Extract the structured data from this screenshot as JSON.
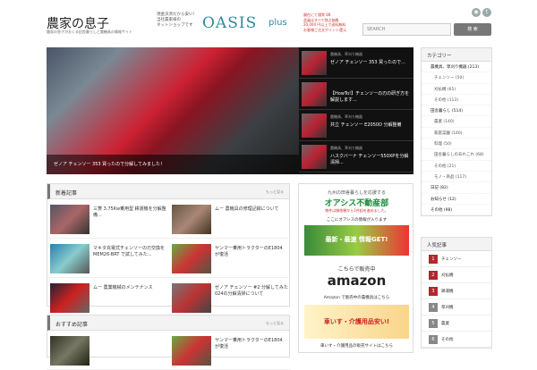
{
  "header": {
    "site_title": "農家の息子",
    "site_description": "農家の息子がおくる田舎暮らしと農機具の情報サイト",
    "banner": {
      "left_text": [
        "現金決済だから安い！",
        "当社農家様の",
        "ネットショップです"
      ],
      "logo": "OASIS",
      "logo_sub": "plus",
      "right_text": [
        "偏在にて通常 88",
        "会員はすべて独占価格",
        "20,000 円以上で送料無料",
        "お客様ご注文ポイント還元"
      ]
    },
    "search": {
      "placeholder": "SEARCH",
      "button_label": "検 索"
    },
    "social": [
      "rss-icon",
      "twitter-icon"
    ]
  },
  "hero": {
    "caption": "ゼノア チェンソー 353 買ったので分解してみました！"
  },
  "slides": [
    {
      "cat": "農機具、草刈り機器",
      "title": "ゼノア チェンソー 353 買ったので..."
    },
    {
      "cat": "",
      "title": "【HowTo!】チェンソーの刃の研ぎ方を解説します..."
    },
    {
      "cat": "農機具、草刈り機器",
      "title": "共立 チェンソー E2050D 分解整備"
    },
    {
      "cat": "農機具、草刈り機器",
      "title": "ハスクバーナ チェンソー550XPを分解清掃..."
    }
  ],
  "section1": {
    "title": "新着記事",
    "more": "もっと見る",
    "posts": [
      {
        "title": "三菱 3.75Kw乗用型 耕運機を分解整備..."
      },
      {
        "title": "ムー 農機具の修理記録について"
      },
      {
        "title": "マキタ充電式チェンソーの刃交換をMEM26-BRT で試してみた..."
      },
      {
        "title": "ヤンマー乗用トラクターのE1804 が復活"
      },
      {
        "title": "ムー 農業機械のメンテナンス"
      },
      {
        "title": "ゼノア チェンソー #2 分解してみた 024の分解清掃について"
      }
    ]
  },
  "section2": {
    "title": "おすすめ記事",
    "more": "もっと見る",
    "posts": [
      {
        "title": ""
      },
      {
        "title": "ヤンマー乗用トラクターのE1804 が復活"
      }
    ]
  },
  "ads": {
    "ad1_title": "九州の田舎暮らしを応援する",
    "ad1_logo": "オアシス不動産部",
    "ad1_sub": "物件は御依頼から1件起を進めました。",
    "ad1_caption": "ここにオアシスの情報が入ります",
    "ad2_text": "最新・最速 情報GET!",
    "ad3_text": "こちらで販売中",
    "ad3_logo": "amazon",
    "ad3_caption": "Amazon で販売中の農機具はこちら",
    "ad4_text": "車いす・介護用品安い!",
    "ad4_caption": "車いす・介護用品の販売サイトはこちら"
  },
  "sidebar": {
    "title": "カテゴリー",
    "categories": [
      {
        "label": "農機具、草刈り機器 (213)",
        "sub": false
      },
      {
        "label": "チェンソー (50)",
        "sub": true
      },
      {
        "label": "刈払機 (65)",
        "sub": true
      },
      {
        "label": "その他 (113)",
        "sub": true
      },
      {
        "label": "田舎暮らし (514)",
        "sub": false
      },
      {
        "label": "農業 (140)",
        "sub": true
      },
      {
        "label": "家庭菜園 (140)",
        "sub": true
      },
      {
        "label": "料理 (50)",
        "sub": true
      },
      {
        "label": "田舎暮らしのあれこれ (68)",
        "sub": true
      },
      {
        "label": "その他 (21)",
        "sub": true
      },
      {
        "label": "モノ・商品 (117)",
        "sub": true
      },
      {
        "label": "日記 (82)",
        "sub": false
      },
      {
        "label": "お知らせ (12)",
        "sub": false
      },
      {
        "label": "その他 (98)",
        "sub": false
      }
    ]
  },
  "ranking": {
    "title": "人気記事",
    "items": [
      {
        "num": "1",
        "label": "チェンソー",
        "color": "#b3262d"
      },
      {
        "num": "2",
        "label": "刈払機",
        "color": "#b3262d"
      },
      {
        "num": "3",
        "label": "耕運機",
        "color": "#b3262d"
      },
      {
        "num": "4",
        "label": "草刈機",
        "color": "#888888"
      },
      {
        "num": "5",
        "label": "農業",
        "color": "#888888"
      },
      {
        "num": "6",
        "label": "その他",
        "color": "#888888"
      }
    ]
  }
}
